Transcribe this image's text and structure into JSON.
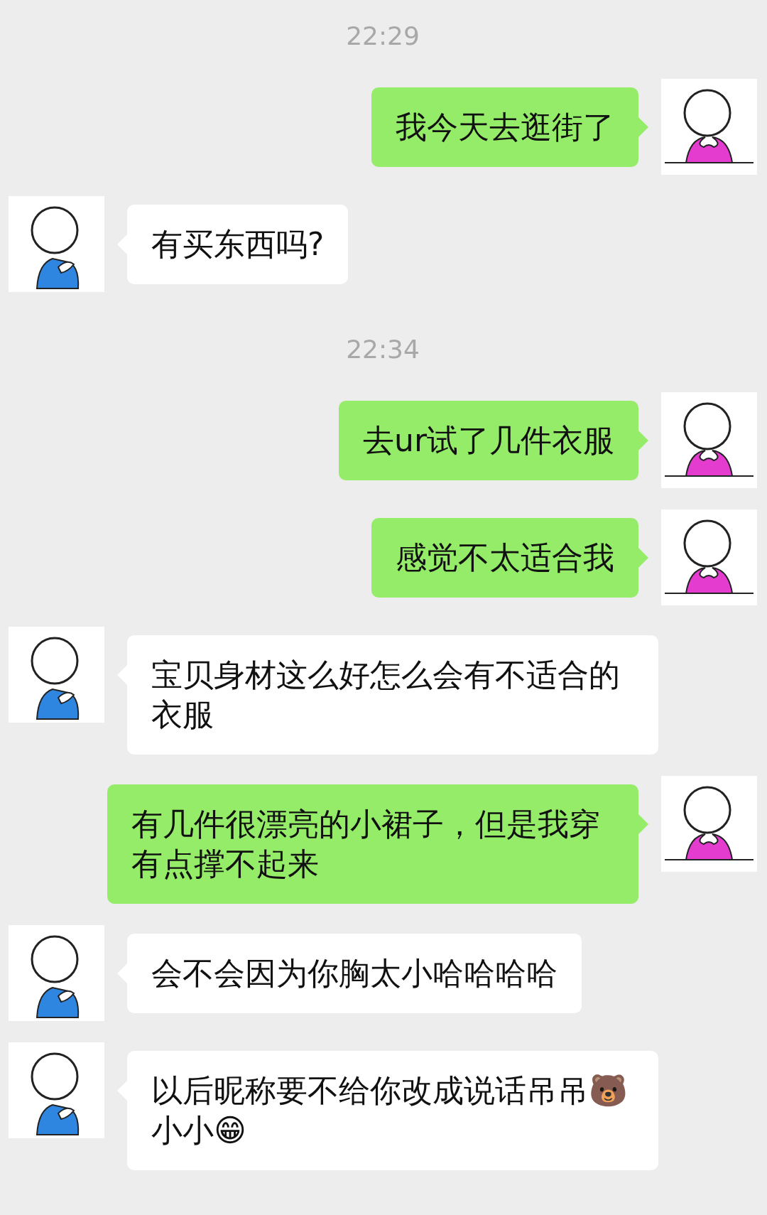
{
  "messages": [
    {
      "kind": "time",
      "text": "22:29"
    },
    {
      "kind": "sent",
      "text": "我今天去逛街了"
    },
    {
      "kind": "received",
      "text": "有买东西吗?"
    },
    {
      "kind": "time",
      "text": "22:34"
    },
    {
      "kind": "sent",
      "text": "去ur试了几件衣服"
    },
    {
      "kind": "sent",
      "text": "感觉不太适合我"
    },
    {
      "kind": "received",
      "text": "宝贝身材这么好怎么会有不适合的衣服"
    },
    {
      "kind": "sent",
      "text": "有几件很漂亮的小裙子，但是我穿有点撑不起来"
    },
    {
      "kind": "received",
      "text": "会不会因为你胸太小哈哈哈哈"
    },
    {
      "kind": "received",
      "text": "以后昵称要不给你改成说话吊吊🐻小小😁"
    }
  ]
}
